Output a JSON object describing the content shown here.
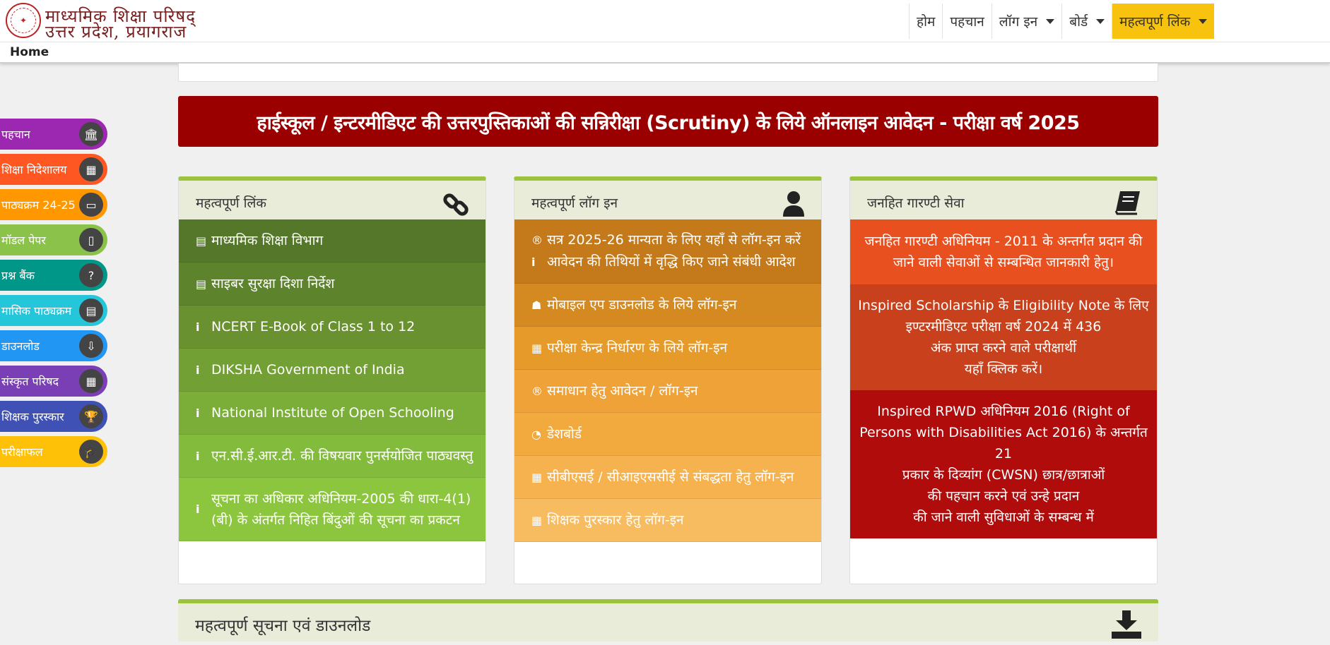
{
  "header": {
    "brand_line1": "माध्यमिक शिक्षा परिषद्",
    "brand_line2": "उत्तर प्रदेश, प्रयागराज",
    "logo_icon": "up-emblem-icon"
  },
  "nav": [
    {
      "label": "होम"
    },
    {
      "label": "पहचान"
    },
    {
      "label": "लॉग इन"
    },
    {
      "label": "बोर्ड"
    },
    {
      "label": "महत्वपूर्ण लिंक"
    }
  ],
  "breadcrumb": "Home",
  "sidebar": [
    {
      "label": "पहचान",
      "color": "#9c27b0",
      "icon": "bank-icon",
      "glyph": "🏛"
    },
    {
      "label": "शिक्षा निदेशालय",
      "color": "#ff5722",
      "icon": "building-icon",
      "glyph": "▦"
    },
    {
      "label": "पाठ्यक्रम 24-25",
      "color": "#ff9800",
      "icon": "book-icon",
      "glyph": "▭"
    },
    {
      "label": "मॉडल पेपर",
      "color": "#8bc34a",
      "icon": "file-icon",
      "glyph": "▯"
    },
    {
      "label": "प्रश्न बैंक",
      "color": "#009688",
      "icon": "question-icon",
      "glyph": "?"
    },
    {
      "label": "मासिक पाठ्यक्रम",
      "color": "#26c6da",
      "icon": "calendar-icon",
      "glyph": "▤"
    },
    {
      "label": "डाउनलोड",
      "color": "#2196f3",
      "icon": "download-icon",
      "glyph": "⇩"
    },
    {
      "label": "संस्कृत परिषद",
      "color": "#7b3fb5",
      "icon": "building-icon",
      "glyph": "▦"
    },
    {
      "label": "शिक्षक पुरस्कार",
      "color": "#3f51b5",
      "icon": "trophy-icon",
      "glyph": "🏆"
    },
    {
      "label": "परीक्षाफल",
      "color": "#ffc107",
      "icon": "graduation-cap-icon",
      "glyph": "🎓"
    }
  ],
  "banner": "हाईस्कूल / इन्टरमीडिएट की उत्तरपुस्तिकाओं की सन्निरीक्षा (Scrutiny) के लिये ऑनलाइन आवेदन - परीक्षा वर्ष 2025",
  "panel_links": {
    "title": "महत्वपूर्ण लिंक",
    "icon": "link-icon",
    "items": [
      {
        "label": "माध्यमिक शिक्षा विभाग",
        "icon": "file-icon",
        "glyph": "▤",
        "color": "#55772a"
      },
      {
        "label": "साइबर सुरक्षा दिशा निर्देश",
        "icon": "file-icon",
        "glyph": "▤",
        "color": "#5d842c"
      },
      {
        "label": "NCERT E-Book of Class 1 to 12",
        "icon": "info-icon",
        "glyph": "i",
        "color": "#699130"
      },
      {
        "label": "DIKSHA Government of India",
        "icon": "info-icon",
        "glyph": "i",
        "color": "#72a034"
      },
      {
        "label": "National Institute of Open Schooling",
        "icon": "info-icon",
        "glyph": "i",
        "color": "#7bae38"
      },
      {
        "label": "एन.सी.ई.आर.टी. की विषयवार पुनर्सयोजित पाठ्यवस्तु",
        "icon": "info-icon",
        "glyph": "i",
        "color": "#83bc3c"
      },
      {
        "label": "सूचना का अधिकार अधिनियम-2005 की धारा-4(1)",
        "label2": "(बी) के अंतर्गत निहित बिंदुओं की सूचना का प्रकटन",
        "icon": "info-icon",
        "glyph": "i",
        "color": "#8cc63f"
      }
    ]
  },
  "panel_login": {
    "title": "महत्वपूर्ण लॉग इन",
    "icon": "user-icon",
    "items": [
      {
        "label": "सत्र 2025-26 मान्यता के लिए यहाँ से लॉग-इन करें",
        "label2": "आवेदन की तिथियों में वृद्धि किए जाने संबंधी आदेश",
        "icon": "registered-icon",
        "glyph": "®",
        "icon2": "info-icon",
        "glyph2": "i",
        "color": "#c47a1a"
      },
      {
        "label": "मोबाइल एप डाउनलोड के लिये लॉग-इन",
        "icon": "android-icon",
        "glyph": "☗",
        "color": "#d48a20"
      },
      {
        "label": "परीक्षा केन्द्र निर्धारण के लिये लॉग-इन",
        "icon": "building-icon",
        "glyph": "▦",
        "color": "#e59a2a"
      },
      {
        "label": "समाधान हेतु आवेदन / लॉग-इन",
        "icon": "registered-icon",
        "glyph": "®",
        "color": "#eea238"
      },
      {
        "label": "डेशबोर्ड",
        "icon": "dashboard-icon",
        "glyph": "◔",
        "color": "#f2aa3e"
      },
      {
        "label": "सीबीएसई / सीआइएससीई से संबद्धता हेतु लॉग-इन",
        "icon": "building-icon",
        "glyph": "▦",
        "color": "#f5b24f"
      },
      {
        "label": "शिक्षक पुरस्कार हेतु लॉग-इन",
        "icon": "building-icon",
        "glyph": "▦",
        "color": "#f7bb60"
      }
    ]
  },
  "panel_guarantee": {
    "title": "जनहित गारण्टी सेवा",
    "icon": "book-icon",
    "items": [
      {
        "lines": [
          "जनहित गारण्टी अधिनियम - 2011 के अन्तर्गत प्रदान की",
          "जाने वाली सेवाओं से सम्बन्धित जानकारी हेतु।"
        ],
        "color": "#e8501f"
      },
      {
        "lines": [
          "Inspired Scholarship के Eligibility Note के लिए",
          "इण्टरमीडिएट परीक्षा वर्ष 2024 में 436",
          "अंक प्राप्त करने वाले परीक्षार्थी",
          "यहाँ क्लिक करें।"
        ],
        "color": "#c8401c"
      },
      {
        "lines": [
          "Inspired RPWD अधिनियम 2016 (Right of",
          "Persons with Disabilities Act 2016) के अन्तर्गत 21",
          "प्रकार के दिव्यांग (CWSN) छात्र/छात्राओं",
          "की पहचान करने एवं उन्हे प्रदान",
          "की जाने वाली सुविधाओं के सम्बन्ध में"
        ],
        "color": "#b00c0c"
      }
    ]
  },
  "bottom_panel": {
    "title": "महत्वपूर्ण सूचना एवं डाउनलोड",
    "icon": "download-icon"
  }
}
